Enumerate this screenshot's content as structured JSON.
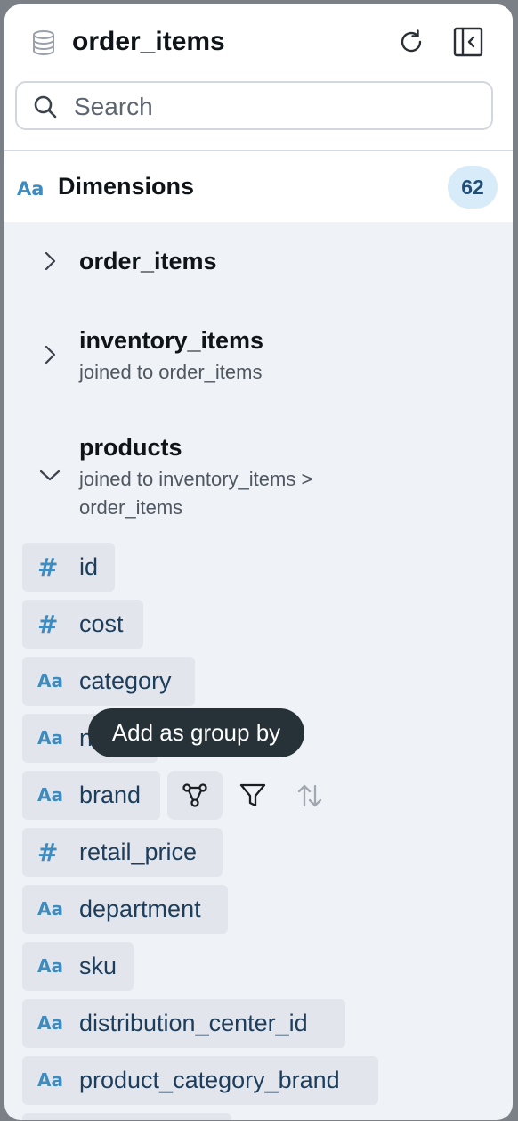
{
  "header": {
    "title": "order_items",
    "icons": {
      "db": "database-icon",
      "refresh": "refresh-icon",
      "collapse": "collapse-sidebar-icon"
    }
  },
  "search": {
    "placeholder": "Search",
    "value": ""
  },
  "dimensions": {
    "icon": "Aa",
    "label": "Dimensions",
    "count": "62"
  },
  "groups": [
    {
      "name": "order_items",
      "subtitle": "",
      "expanded": false
    },
    {
      "name": "inventory_items",
      "subtitle": "joined to order_items",
      "expanded": false
    },
    {
      "name": "products",
      "subtitle_line1": "joined to inventory_items >",
      "subtitle_line2": "order_items",
      "expanded": true
    }
  ],
  "fields": [
    {
      "type": "#",
      "name": "id"
    },
    {
      "type": "#",
      "name": "cost"
    },
    {
      "type": "Aa",
      "name": "category"
    },
    {
      "type": "Aa",
      "name": "name"
    },
    {
      "type": "Aa",
      "name": "brand"
    },
    {
      "type": "#",
      "name": "retail_price"
    },
    {
      "type": "Aa",
      "name": "department"
    },
    {
      "type": "Aa",
      "name": "sku"
    },
    {
      "type": "Aa",
      "name": "distribution_center_id"
    },
    {
      "type": "Aa",
      "name": "product_category_brand"
    }
  ],
  "tooltip": {
    "text": "Add as group by"
  },
  "row_actions": {
    "group_by": "group-by-icon",
    "filter": "filter-icon",
    "sort": "sort-icon"
  }
}
